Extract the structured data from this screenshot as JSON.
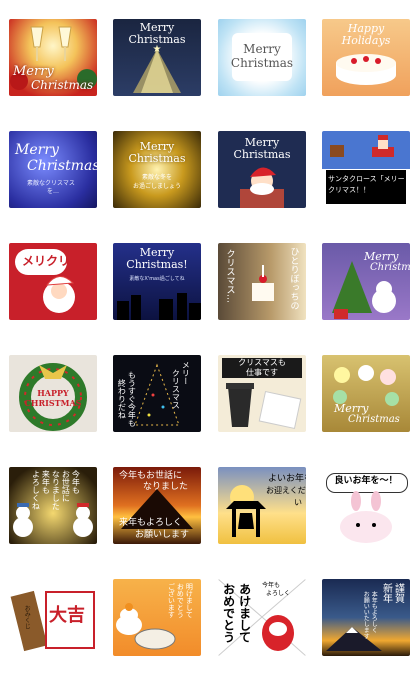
{
  "stickers": [
    {
      "id": 1,
      "lines": [
        "Merry",
        "Christmas"
      ]
    },
    {
      "id": 2,
      "lines": [
        "Merry",
        "Christmas"
      ]
    },
    {
      "id": 3,
      "lines": [
        "Merry",
        "Christmas"
      ]
    },
    {
      "id": 4,
      "lines": [
        "Happy",
        "Holidays"
      ]
    },
    {
      "id": 5,
      "lines": [
        "Merry",
        "Christmas",
        "素敵なクリスマス",
        "を…"
      ]
    },
    {
      "id": 6,
      "lines": [
        "Merry",
        "Christmas",
        "素敵な冬を",
        "お過ごしましょう"
      ]
    },
    {
      "id": 7,
      "lines": [
        "Merry",
        "Christmas"
      ]
    },
    {
      "id": 8,
      "lines": [
        "サンタクロース「メリー",
        "クリマス！！"
      ]
    },
    {
      "id": 9,
      "lines": [
        "メリクリ"
      ]
    },
    {
      "id": 10,
      "lines": [
        "Merry",
        "Christmas!",
        "素敵なX'mas過ごしてね"
      ]
    },
    {
      "id": 11,
      "lines": [
        "クリスマス…"
      ]
    },
    {
      "id": 12,
      "lines": [
        "ひとりぼっちの"
      ]
    },
    {
      "id": 13,
      "lines": [
        "Merry",
        "Christmas"
      ]
    },
    {
      "id": 14,
      "lines": [
        "HAPPY",
        "CHRISTMAS"
      ]
    },
    {
      "id": 15,
      "lines": [
        "もうすぐ今年も",
        "終わりだね"
      ]
    },
    {
      "id": 16,
      "lines": [
        "メリー",
        "クリスマス"
      ]
    },
    {
      "id": 17,
      "lines": [
        "クリスマスも",
        "仕事です"
      ]
    },
    {
      "id": 18,
      "lines": [
        "Merry",
        "Christmas"
      ]
    },
    {
      "id": 19,
      "lines": [
        "今年も",
        "お世話に",
        "なりました",
        "来年も",
        "よろしくね"
      ]
    },
    {
      "id": 20,
      "lines": [
        "今年もお世話に",
        "なりました",
        "来年もよろしく",
        "お願いします"
      ]
    },
    {
      "id": 21,
      "lines": [
        "よいお年を",
        "お迎えくださ",
        "い"
      ]
    },
    {
      "id": 22,
      "lines": [
        "良いお年を〜！"
      ]
    },
    {
      "id": 23,
      "lines": [
        "おみくじ",
        "大吉"
      ]
    },
    {
      "id": 24,
      "lines": [
        "明けまして",
        "おめでとう",
        "ございます"
      ]
    },
    {
      "id": 25,
      "lines": [
        "今年も",
        "よろしく",
        "あけまして",
        "おめでとう"
      ]
    },
    {
      "id": 26,
      "lines": [
        "謹賀",
        "新年",
        "本年もよろしく",
        "お願いいたします"
      ]
    }
  ]
}
